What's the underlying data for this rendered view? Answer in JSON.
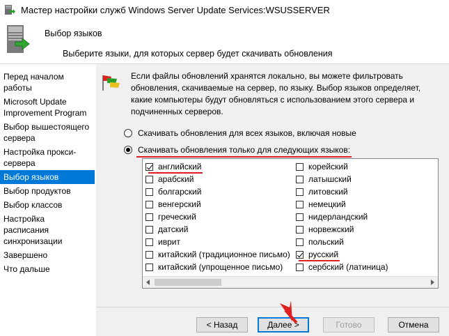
{
  "window": {
    "title": "Мастер настройки служб Windows Server Update Services:WSUSSERVER"
  },
  "header": {
    "title": "Выбор языков",
    "subtitle": "Выберите языки, для которых сервер будет скачивать обновления"
  },
  "sidebar": {
    "items": [
      {
        "label": "Перед началом работы",
        "active": false
      },
      {
        "label": "Microsoft Update Improvement Program",
        "active": false
      },
      {
        "label": "Выбор вышестоящего сервера",
        "active": false
      },
      {
        "label": "Настройка прокси-сервера",
        "active": false
      },
      {
        "label": "Выбор языков",
        "active": true
      },
      {
        "label": "Выбор продуктов",
        "active": false
      },
      {
        "label": "Выбор классов",
        "active": false
      },
      {
        "label": "Настройка расписания синхронизации",
        "active": false
      },
      {
        "label": "Завершено",
        "active": false
      },
      {
        "label": "Что дальше",
        "active": false
      }
    ]
  },
  "info": {
    "text": "Если файлы обновлений хранятся локально, вы можете фильтровать обновления, скачиваемые на сервер, по языку. Выбор языков определяет, какие компьютеры будут обновляться с использованием этого сервера и подчиненных серверов."
  },
  "options": {
    "all_languages": {
      "label": "Скачивать обновления для всех языков, включая новые",
      "checked": false
    },
    "only_languages": {
      "label": "Скачивать обновления только для следующих языков:",
      "checked": true
    }
  },
  "languages": [
    {
      "label": "английский",
      "checked": true
    },
    {
      "label": "корейский",
      "checked": false
    },
    {
      "label": "арабский",
      "checked": false
    },
    {
      "label": "латышский",
      "checked": false
    },
    {
      "label": "болгарский",
      "checked": false
    },
    {
      "label": "литовский",
      "checked": false
    },
    {
      "label": "венгерский",
      "checked": false
    },
    {
      "label": "немецкий",
      "checked": false
    },
    {
      "label": "греческий",
      "checked": false
    },
    {
      "label": "нидерландский",
      "checked": false
    },
    {
      "label": "датский",
      "checked": false
    },
    {
      "label": "норвежский",
      "checked": false
    },
    {
      "label": "иврит",
      "checked": false
    },
    {
      "label": "польский",
      "checked": false
    },
    {
      "label": "китайский (традиционное письмо)",
      "checked": false
    },
    {
      "label": "русский",
      "checked": true
    },
    {
      "label": "китайский (упрощенное письмо)",
      "checked": false
    },
    {
      "label": "сербский (латиница)",
      "checked": false
    }
  ],
  "buttons": {
    "back": "< Назад",
    "next": "Далее >",
    "finish": "Готово",
    "cancel": "Отмена"
  },
  "colors": {
    "accent": "#0078d7",
    "highlight_underline": "#e02020"
  }
}
